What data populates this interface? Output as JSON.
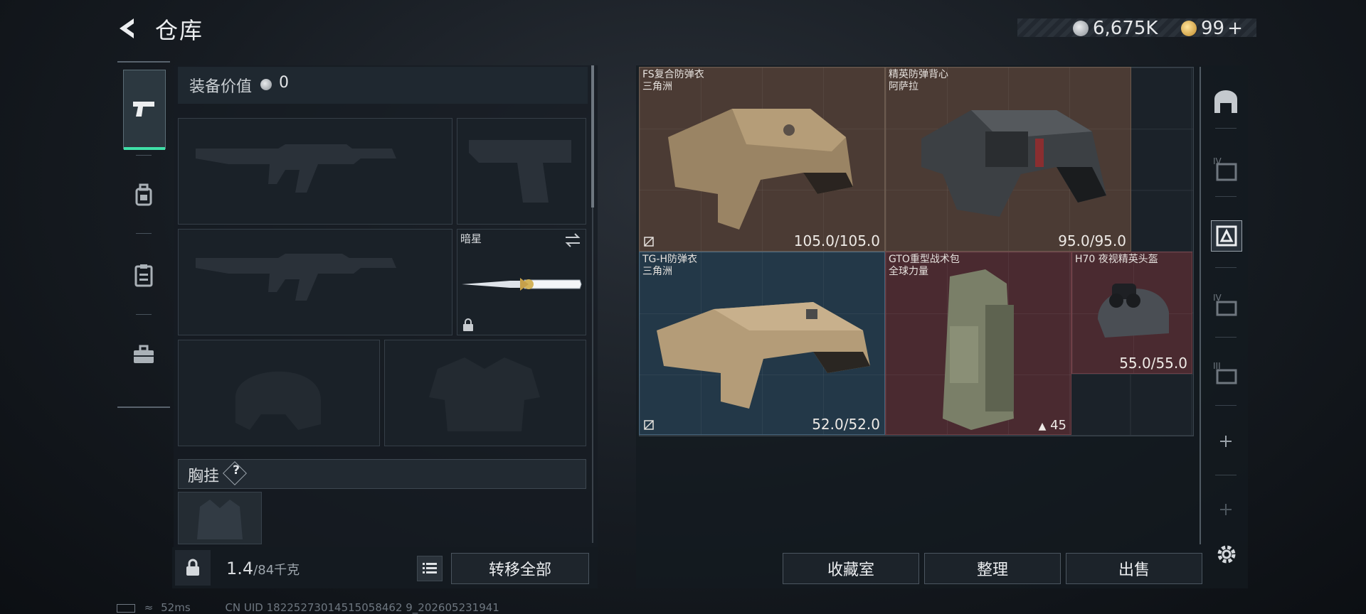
{
  "header": {
    "title": "仓库",
    "currency_silver": "6,675K",
    "currency_gold": "99",
    "plus_label": "+"
  },
  "left_tabs": [
    {
      "name": "weapons",
      "icon": "pistol-icon",
      "active": true
    },
    {
      "name": "gear",
      "icon": "backpack-icon",
      "active": false
    },
    {
      "name": "clipboard",
      "icon": "clipboard-icon",
      "active": false
    },
    {
      "name": "case",
      "icon": "briefcase-icon",
      "active": false
    }
  ],
  "equipment": {
    "value_label": "装备价值",
    "value": "0",
    "secondary_melee_name": "暗星",
    "chest_label": "胸挂",
    "help_symbol": "?"
  },
  "weight": {
    "current": "1.4",
    "max": "/84千克"
  },
  "buttons": {
    "transfer_all": "转移全部",
    "collection_room": "收藏室",
    "organize": "整理",
    "sell": "出售"
  },
  "storage_items": [
    {
      "name_line1": "FS复合防弹衣",
      "name_line2": "三角洲",
      "durability": "105.0/105.0",
      "rarity": "brown"
    },
    {
      "name_line1": "精英防弹背心",
      "name_line2": "阿萨拉",
      "durability": "95.0/95.0",
      "rarity": "brown"
    },
    {
      "name_line1": "TG-H防弹衣",
      "name_line2": "三角洲",
      "durability": "52.0/52.0",
      "rarity": "blue"
    },
    {
      "name_line1": "GTO重型战术包",
      "name_line2": "全球力量",
      "count": "45",
      "rarity": "red"
    },
    {
      "name_line1": "H70 夜视精英头盔",
      "name_line2": "",
      "durability": "55.0/55.0",
      "rarity": "red"
    }
  ],
  "right_tabs": [
    {
      "icon": "vault-icon"
    },
    {
      "icon": "container-iv-icon",
      "label": "IV"
    },
    {
      "icon": "armor-filter-icon"
    },
    {
      "icon": "tier-iv-icon",
      "label": "IV"
    },
    {
      "icon": "tier-iii-icon",
      "label": "III"
    },
    {
      "icon": "plus-icon"
    },
    {
      "icon": "plus-disabled-icon"
    }
  ],
  "status": {
    "ping": "52ms",
    "uid": "CN UID 18225273014515058462 9_202605231941"
  },
  "colors": {
    "accent": "#3fe0a8",
    "item_brown": "#4b3b34",
    "item_blue": "#233848",
    "item_red": "#4a2a30"
  }
}
